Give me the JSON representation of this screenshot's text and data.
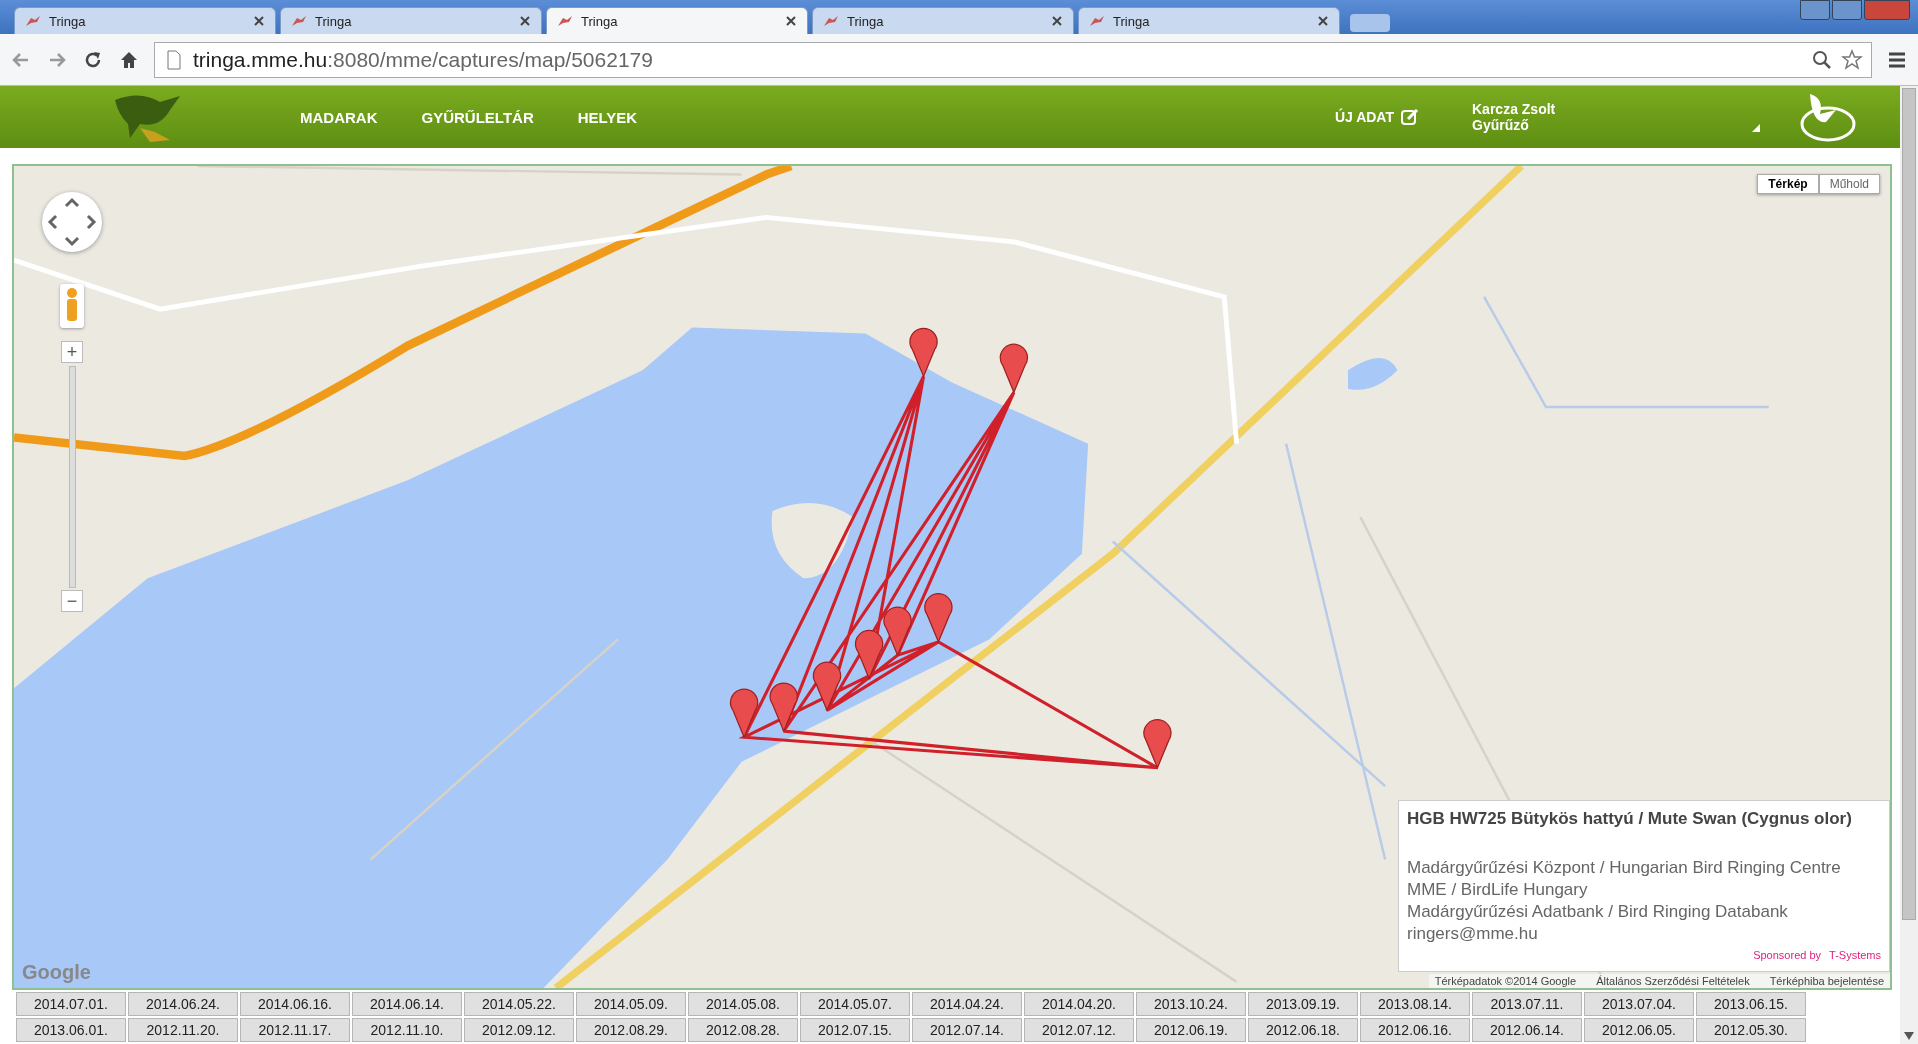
{
  "browser": {
    "tabs": [
      {
        "title": "Tringa",
        "selected": false
      },
      {
        "title": "Tringa",
        "selected": false
      },
      {
        "title": "Tringa",
        "selected": true
      },
      {
        "title": "Tringa",
        "selected": false
      },
      {
        "title": "Tringa",
        "selected": false
      }
    ],
    "address": {
      "host": "tringa.mme.hu",
      "path": ":8080/mme/captures/map/5062179"
    }
  },
  "header": {
    "nav": [
      "MADARAK",
      "GYŰRŰLELTÁR",
      "HELYEK"
    ],
    "new_button": "ÚJ ADAT",
    "user": {
      "name": "Karcza Zsolt",
      "role": "Gyűrűző"
    }
  },
  "map": {
    "type_buttons": [
      {
        "label": "Térkép",
        "selected": true
      },
      {
        "label": "Műhold",
        "selected": false
      }
    ],
    "zoom_in": "+",
    "zoom_out": "−",
    "info": {
      "title": "HGB HW725 Bütykös hattyú / Mute Swan (Cygnus olor)",
      "lines": [
        "Madárgyűrűzési Központ / Hungarian Bird Ringing Centre",
        "MME / BirdLife Hungary",
        "Madárgyűrűzési Adatbank / Bird Ringing Databank",
        "ringers@mme.hu"
      ],
      "sponsor": {
        "label": "Sponsored by",
        "brand": "T-Systems"
      }
    },
    "google": "Google",
    "attribution": [
      "Térképadatok ©2014 Google",
      "Általános Szerződési Feltételek",
      "Térképhiba bejelentése"
    ]
  },
  "dates": [
    [
      "2014.07.01.",
      "2014.06.24.",
      "2014.06.16.",
      "2014.06.14.",
      "2014.05.22.",
      "2014.05.09.",
      "2014.05.08.",
      "2014.05.07.",
      "2014.04.24.",
      "2014.04.20.",
      "2013.10.24.",
      "2013.09.19.",
      "2013.08.14.",
      "2013.07.11.",
      "2013.07.04.",
      "2013.06.15."
    ],
    [
      "2013.06.01.",
      "2012.11.20.",
      "2012.11.17.",
      "2012.11.10.",
      "2012.09.12.",
      "2012.08.29.",
      "2012.08.28.",
      "2012.07.15.",
      "2012.07.14.",
      "2012.07.12.",
      "2012.06.19.",
      "2012.06.18.",
      "2012.06.16.",
      "2012.06.14.",
      "2012.06.05.",
      "2012.05.30."
    ]
  ]
}
